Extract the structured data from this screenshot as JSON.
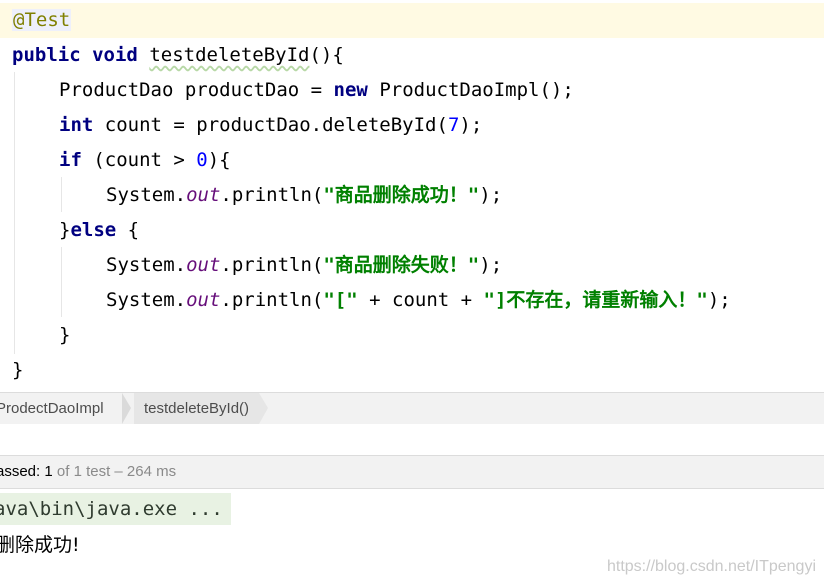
{
  "editor": {
    "lines": [
      {
        "annotation": "@Test"
      },
      {
        "kw_public": "public",
        "kw_void": "void",
        "method": "testdeleteById",
        "rest": "(){"
      },
      {
        "type1": "ProductDao productDao = ",
        "kw_new": "new",
        "type2": " ProductDaoImpl();"
      },
      {
        "kw_int": "int",
        "p1": " count = productDao.deleteById(",
        "num": "7",
        "p2": ");"
      },
      {
        "kw_if": "if",
        "p1": " (count > ",
        "num": "0",
        "p2": "){"
      },
      {
        "p1": "System.",
        "fld": "out",
        "p2": ".println(",
        "str": "\"商品删除成功！\"",
        "p3": ");"
      },
      {
        "p1": "}",
        "kw_else": "else",
        "p2": " {"
      },
      {
        "p1": "System.",
        "fld": "out",
        "p2": ".println(",
        "str": "\"商品删除失败！\"",
        "p3": ");"
      },
      {
        "p1": "System.",
        "fld": "out",
        "p2": ".println(",
        "str1": "\"[\"",
        "p3": " + count + ",
        "str2": "\"]不存在，请重新输入！\"",
        "p4": ");"
      },
      {
        "p1": "}"
      },
      {
        "p1": "}"
      }
    ]
  },
  "breadcrumb": {
    "class_name": "ProdectDaoImpl",
    "method_name": "testdeleteById()"
  },
  "status": {
    "passed_label": "assed: 1",
    "rest": " of 1 test – 264 ms"
  },
  "console": {
    "command": "ava\\bin\\java.exe ...",
    "output": "删除成功!"
  },
  "watermark": "https://blog.csdn.net/ITpengyi",
  "colors": {
    "keyword": "#000080",
    "string": "#008000",
    "number": "#0000ff",
    "annotation": "#808000",
    "field": "#660e7a",
    "current_line": "#fffae3"
  }
}
